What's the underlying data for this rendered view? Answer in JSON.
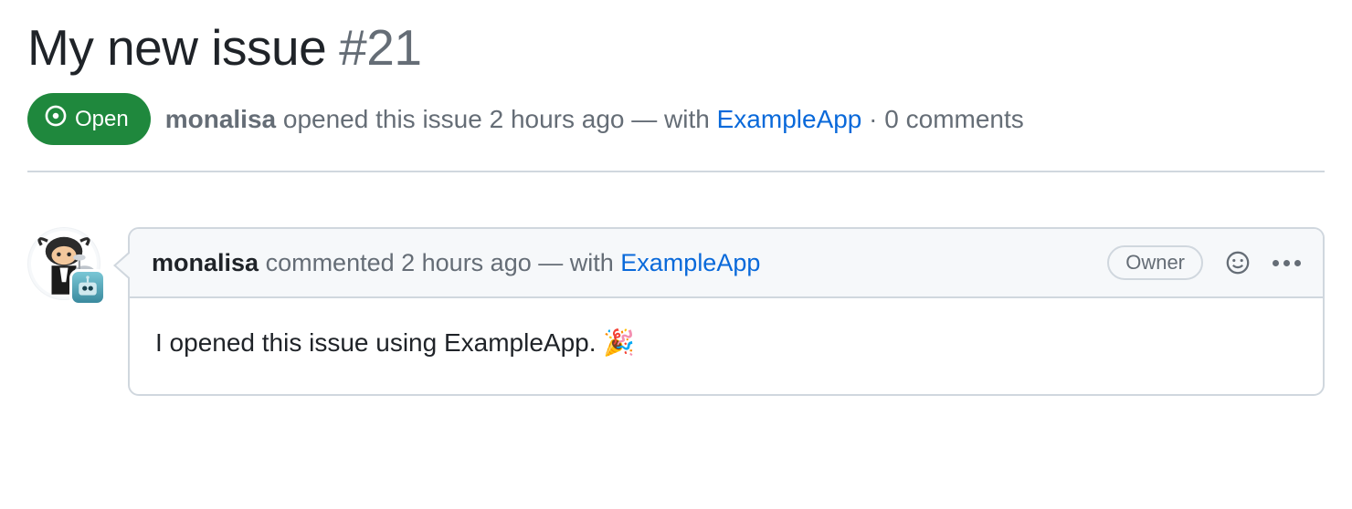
{
  "issue": {
    "title": "My new issue",
    "number": "#21",
    "state": "Open",
    "author": "monalisa",
    "opened_text_mid": "opened this issue 2 hours ago — with",
    "app_name": "ExampleApp",
    "comments_text": "· 0 comments"
  },
  "comment": {
    "author": "monalisa",
    "commented_text_mid": "commented 2 hours ago — with",
    "app_name": "ExampleApp",
    "role": "Owner",
    "body": "I opened this issue using ExampleApp. 🎉"
  }
}
